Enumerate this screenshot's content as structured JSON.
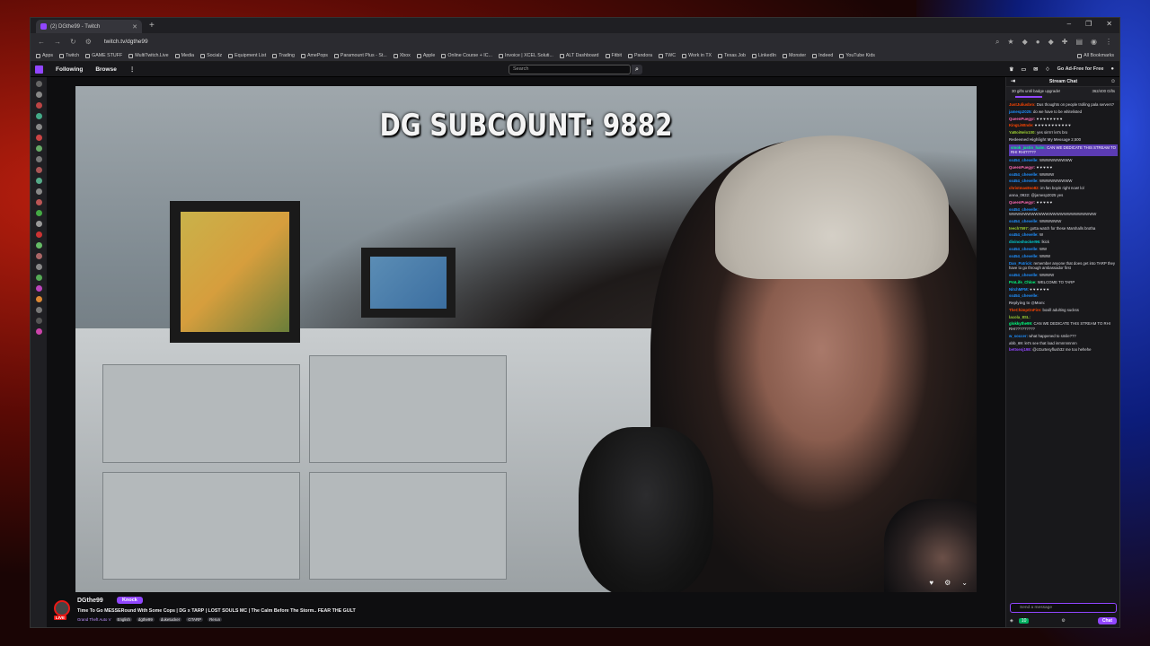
{
  "browser": {
    "tab_title": "(2) DGthe99 - Twitch",
    "new_tab_icon": "+",
    "url": "twitch.tv/dgthe99",
    "bookmarks": [
      "Apps",
      "Twitch",
      "GAME STUFF",
      "MultiTwitch.Live",
      "Media",
      "Socialz",
      "Equipment List",
      "Trading",
      "AmePops",
      "Paramount Plus - St...",
      "Xbox",
      "Apple",
      "Online Course + IC...",
      "Invoice | XCEL Soluti...",
      "ALT Dashboard",
      "Fitbit",
      "Pandora",
      "TWC",
      "Work in TX",
      "Texas Job",
      "LinkedIn",
      "Monster",
      "Indeed",
      "YouTube Kids"
    ],
    "all_bookmarks": "All Bookmarks"
  },
  "twitch_nav": {
    "following": "Following",
    "browse": "Browse",
    "more": "⋮",
    "search_placeholder": "Search",
    "ad_free": "Go Ad-Free for Free"
  },
  "video": {
    "overlay_text": "DG SUBCOUNT: 9882"
  },
  "stream_info": {
    "channel": "DGthe99",
    "knock_label": "Knock",
    "live": "LIVE",
    "title": "Time To Go MESSERound With Some Cops | DG x TARP | LOST SOULS MC | The Calm Before The Storm.. FEAR THE GULT",
    "game": "Grand Theft Auto V",
    "tags": [
      "English",
      "dgthe99",
      "duketucker",
      "GTARP",
      "Rerun"
    ]
  },
  "chat": {
    "header": "Stream Chat",
    "gift_left": "30 gifts until badge upgrade!",
    "gift_right": "362/400 Gifts",
    "messages": [
      {
        "user": "JustJuliusbro:",
        "text": "Dus thoughts on people trolling pala servers?",
        "color": "#ff4500"
      },
      {
        "user": "jamesp2025:",
        "text": "do we have to be whitelisted",
        "color": "#1e90ff"
      },
      {
        "user": "QueenPuegyr:",
        "text": "♥ ♥ ♥ ♥ ♥ ♥ ♥ ♥",
        "color": "#ff69b4"
      },
      {
        "user": "KingLiMtnde:",
        "text": "♥ ♥ ♥ ♥ ♥ ♥ ♥ ♥ ♥ ♥ ♥",
        "color": "#ff4500"
      },
      {
        "user": "YaBoiNelo100:",
        "text": "yes sirrrrr let's bro",
        "color": "#9acd32"
      },
      {
        "user": "Redeemed Highlight My Message",
        "text": "2,500",
        "color": "#adadb8"
      },
      {
        "user": "smok_justin_halm:",
        "text": "CAN WE DEDICATE THIS STREAM TO RHI RHI?????",
        "color": "#00ff7f",
        "hl": true
      },
      {
        "user": "ss454_chevelle:",
        "text": "WWWWWWWWW",
        "color": "#1e90ff"
      },
      {
        "user": "QueenPuegyr:",
        "text": "♥ ♥ ♥ ♥ ♥",
        "color": "#ff69b4"
      },
      {
        "user": "ss454_chevelle:",
        "text": "WWWW",
        "color": "#1e90ff"
      },
      {
        "user": "ss454_chevelle:",
        "text": "WWWWWWWWW",
        "color": "#1e90ff"
      },
      {
        "user": "christmas8so82:",
        "text": "im fan boyin right now! lol",
        "color": "#ff4500"
      },
      {
        "user": "anna_0922:",
        "text": "@jamesp2025 yes",
        "color": "#adadb8"
      },
      {
        "user": "QueenPuegyr:",
        "text": "♥ ♥ ♥ ♥ ♥",
        "color": "#ff69b4"
      },
      {
        "user": "ss454_chevelle:",
        "text": "WWWWWWWWWWWWWWWWWWWWWWWW",
        "color": "#1e90ff"
      },
      {
        "user": "ss454_chevelle:",
        "text": "WWWWWW",
        "color": "#1e90ff"
      },
      {
        "user": "teech7597:",
        "text": "gotta watch for these Marshalls brotha",
        "color": "#9acd32"
      },
      {
        "user": "ss454_chevelle:",
        "text": "W",
        "color": "#1e90ff"
      },
      {
        "user": "divinoshocker96:",
        "text": "lkick",
        "color": "#00ced1"
      },
      {
        "user": "ss454_chevelle:",
        "text": "WW",
        "color": "#1e90ff"
      },
      {
        "user": "ss454_chevelle:",
        "text": "WWW",
        "color": "#1e90ff"
      },
      {
        "user": "Dan_Patrick:",
        "text": "remember anyone that does get into TARP they have to go through ambassador first",
        "color": "#1e90ff"
      },
      {
        "user": "ss454_chevelle:",
        "text": "WWWW",
        "color": "#1e90ff"
      },
      {
        "user": "ProLife_Chloe:",
        "text": "WELCOME TO TARP",
        "color": "#00ff7f"
      },
      {
        "user": "NitchMFM:",
        "text": "♥ ♥ ♥ ♥ ♥ ♥",
        "color": "#1e90ff"
      },
      {
        "user": "ss454_chevelle:",
        "text": "",
        "color": "#1e90ff"
      },
      {
        "user": "Replying to @Mom:",
        "text": "",
        "color": "#adadb8"
      },
      {
        "user": "TheChimpOnFire:",
        "text": "boxill adulting suckss",
        "color": "#ff4500"
      },
      {
        "user": "lacola_8SL:",
        "text": "",
        "color": "#9acd32"
      },
      {
        "user": "glokkythe99:",
        "text": "CAN WE DEDICATE THIS STREAM TO RHI RHI?????????",
        "color": "#00ff7f"
      },
      {
        "user": "w_soccer:",
        "text": "what happened to smile???",
        "color": "#1e90ff"
      },
      {
        "user": "abb_69:",
        "text": "let's see that load inmnnnnnnn",
        "color": "#adadb8"
      },
      {
        "user": "bettsenj198:",
        "text": "@cGurtesyflush32 me too hehehe",
        "color": "#9146ff"
      }
    ],
    "input_placeholder": "Send a message",
    "points": "10",
    "chat_button": "Chat"
  },
  "colors": {
    "twitch_purple": "#9146ff",
    "live_red": "#e91916"
  }
}
